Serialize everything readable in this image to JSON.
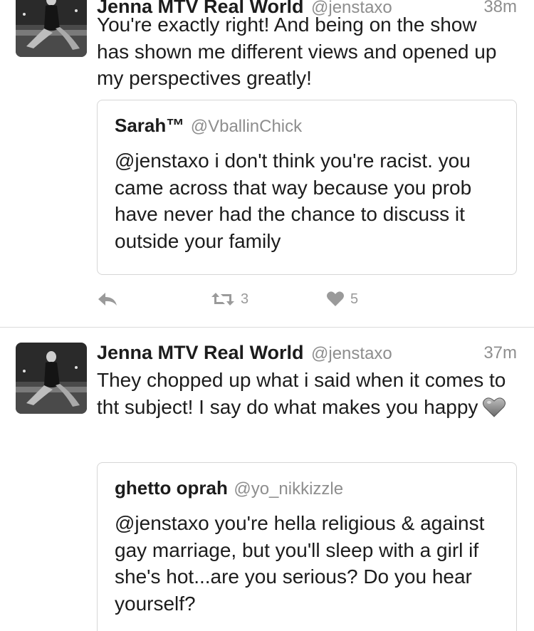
{
  "tweets": [
    {
      "name": "Jenna MTV Real World",
      "handle": "@jenstaxo",
      "time": "38m",
      "text": "You're exactly right! And being on the show has shown me different views and opened up my perspectives greatly!",
      "quote": {
        "name": "Sarah™",
        "handle": "@VballinChick",
        "text": "@jenstaxo i don't think you're racist. you came across that way because you prob have never had the chance to discuss it outside your family"
      },
      "retweets": "3",
      "likes": "5"
    },
    {
      "name": "Jenna MTV Real World",
      "handle": "@jenstaxo",
      "time": "37m",
      "text": "They chopped up what i said when it comes to tht subject! I say do what makes you happy",
      "emoji": "grey-heart-emoji",
      "quote": {
        "name": "ghetto oprah",
        "handle": "@yo_nikkizzle",
        "text": "@jenstaxo you're hella religious & against gay marriage, but you'll sleep with a girl if she's hot...are you serious? Do you hear yourself?"
      }
    }
  ],
  "icons": {
    "reply": "reply-icon",
    "retweet": "retweet-icon",
    "like": "heart-icon"
  },
  "colors": {
    "text": "#1c1c1c",
    "secondary": "#8e8e8e",
    "icon": "#9a9a9a",
    "border": "#d6d6d6"
  }
}
